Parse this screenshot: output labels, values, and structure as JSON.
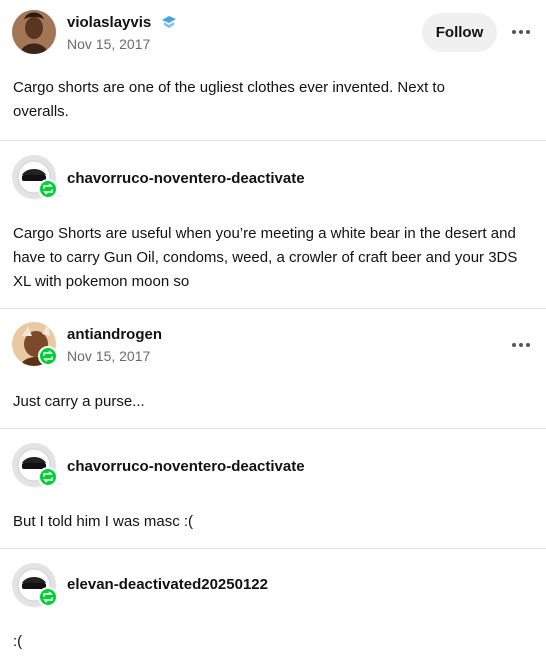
{
  "posts": [
    {
      "username": "violaslayvis",
      "date": "Nov 15, 2017",
      "follow_label": "Follow",
      "text": "Cargo shorts are one of the ugliest clothes ever invented. Next to overalls."
    },
    {
      "username": "chavorruco-noventero-deactivate",
      "text": "Cargo Shorts are useful when you’re meeting a white bear in the desert and have to carry Gun Oil, condoms, weed, a crowler of craft beer and your 3DS XL with pokemon moon so"
    },
    {
      "username": "antiandrogen",
      "date": "Nov 15, 2017",
      "text": "Just carry a purse..."
    },
    {
      "username": "chavorruco-noventero-deactivate",
      "text": "But I told him I was masc :("
    },
    {
      "username": "elevan-deactivated20250122",
      "text": ":("
    }
  ],
  "colors": {
    "reblog_green": "#00cf35",
    "divider": "#dedede",
    "date_gray": "#6b6b6b"
  },
  "icons": [
    "verified-badge-icon",
    "more-options-icon",
    "reblog-icon",
    "sunglasses-avatar-icon"
  ]
}
